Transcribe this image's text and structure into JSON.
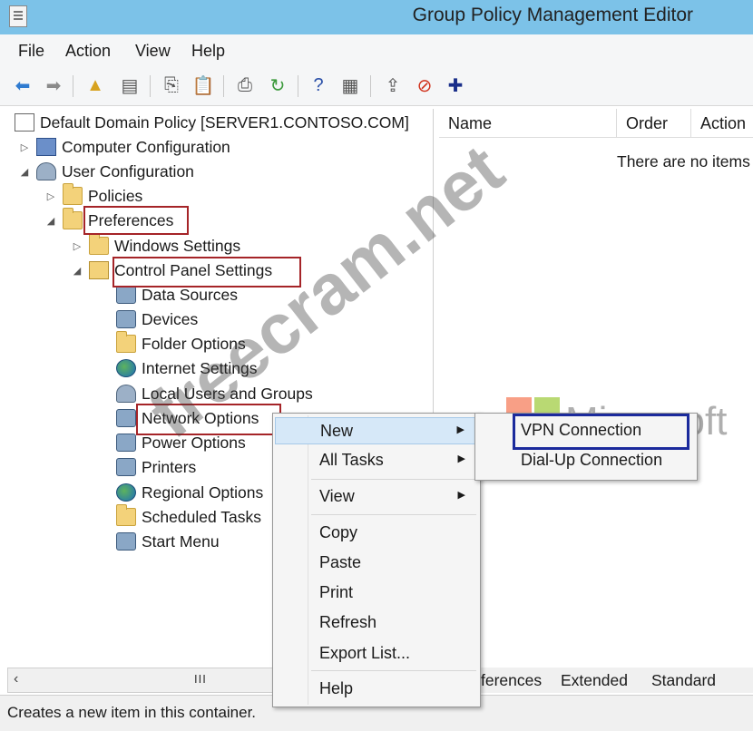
{
  "window": {
    "title": "Group Policy Management Editor"
  },
  "menubar": {
    "items": [
      "File",
      "Action",
      "View",
      "Help"
    ]
  },
  "toolbar": {
    "buttons": [
      {
        "icon": "back-arrow-icon",
        "glyph": "⬅",
        "color": "#2f7bd0"
      },
      {
        "icon": "forward-arrow-icon",
        "glyph": "➡",
        "color": "#8a8a8a"
      },
      {
        "icon": "up-folder-icon",
        "glyph": "▲",
        "color": "#d7a21f"
      },
      {
        "icon": "show-hide-tree-icon",
        "glyph": "▤",
        "color": "#555555"
      },
      {
        "icon": "copy-icon",
        "glyph": "⎘",
        "color": "#555555"
      },
      {
        "icon": "paste-icon",
        "glyph": "📋",
        "color": "#555555"
      },
      {
        "icon": "print-icon",
        "glyph": "⎙",
        "color": "#555555"
      },
      {
        "icon": "refresh-icon",
        "glyph": "↻",
        "color": "#3c9a3c"
      },
      {
        "icon": "help-icon",
        "glyph": "?",
        "color": "#2a4fa8"
      },
      {
        "icon": "properties-icon",
        "glyph": "▦",
        "color": "#555555"
      },
      {
        "icon": "export-icon",
        "glyph": "⇪",
        "color": "#555555"
      },
      {
        "icon": "stop-icon",
        "glyph": "⊘",
        "color": "#d0301a"
      },
      {
        "icon": "add-icon",
        "glyph": "✚",
        "color": "#1a2f8a"
      }
    ]
  },
  "tree": {
    "root": "Default Domain Policy [SERVER1.CONTOSO.COM]",
    "computer_configuration": "Computer Configuration",
    "user_configuration": "User Configuration",
    "policies": "Policies",
    "preferences": "Preferences",
    "windows_settings": "Windows Settings",
    "control_panel_settings": "Control Panel Settings",
    "children": [
      "Data Sources",
      "Devices",
      "Folder Options",
      "Internet Settings",
      "Local Users and Groups",
      "Network Options",
      "Power Options",
      "Printers",
      "Regional Options",
      "Scheduled Tasks",
      "Start Menu"
    ]
  },
  "list": {
    "columns": [
      "Name",
      "Order",
      "Action"
    ],
    "empty_message": "There are no items"
  },
  "tabs": [
    "ferences",
    "Extended",
    "Standard"
  ],
  "status": {
    "text": "Creates a new item in this container."
  },
  "context_menu": {
    "items": [
      "New",
      "All Tasks",
      "View",
      "Copy",
      "Paste",
      "Print",
      "Refresh",
      "Export List...",
      "Help"
    ]
  },
  "submenu": {
    "items": [
      "VPN Connection",
      "Dial-Up Connection"
    ]
  },
  "overlay": {
    "watermark": "freecram.net",
    "brand_word": "Microsoft",
    "logo_colors": [
      "#f25022",
      "#7fba00",
      "#00a4ef",
      "#ffb900"
    ]
  },
  "scroll": {
    "grip": "III"
  },
  "colors": {
    "highlight_box": "#a52428",
    "vpn_box": "#1b2a9c",
    "titlebar": "#7cc2e8"
  }
}
